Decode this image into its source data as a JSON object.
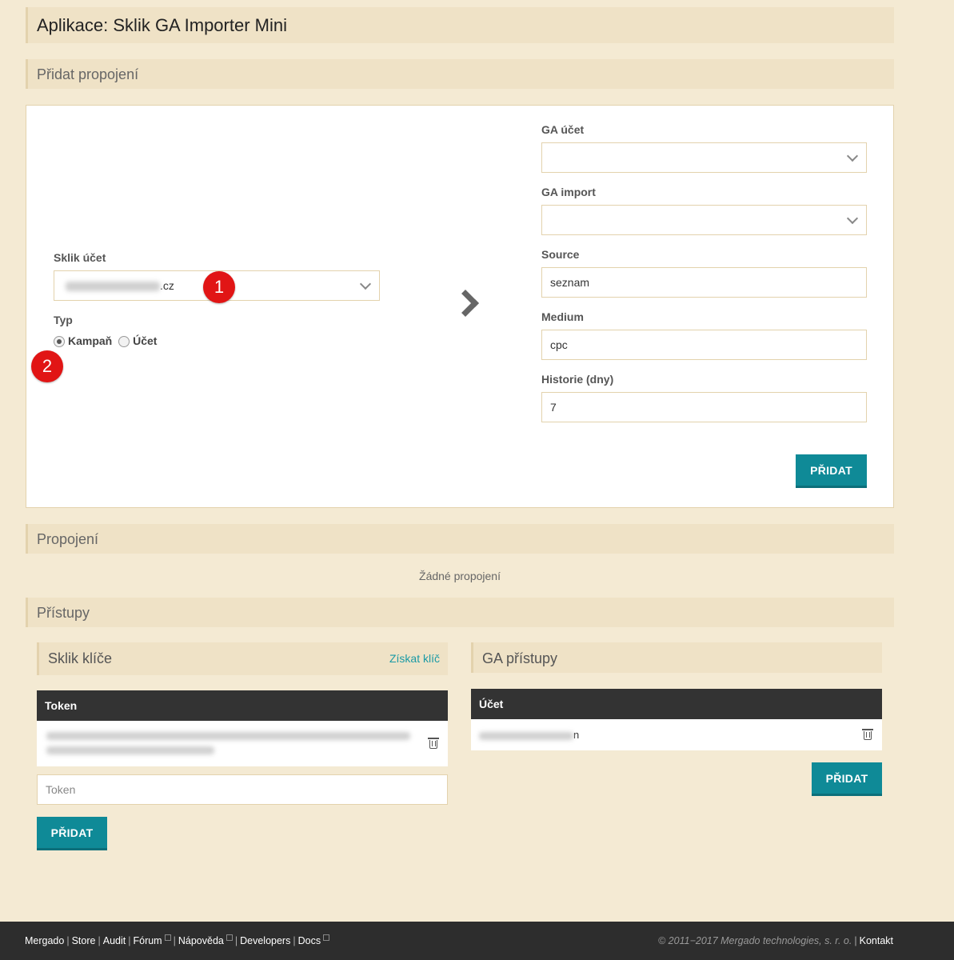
{
  "header": {
    "title": "Aplikace: Sklik GA Importer Mini"
  },
  "add_section": {
    "title": "Přidat propojení",
    "sklik_account_label": "Sklik účet",
    "sklik_account_suffix": ".cz",
    "type_label": "Typ",
    "type_options": [
      "Kampaň",
      "Účet"
    ],
    "type_selected": "Kampaň",
    "badge_1": "1",
    "badge_2": "2",
    "ga_account_label": "GA účet",
    "ga_import_label": "GA import",
    "source_label": "Source",
    "source_value": "seznam",
    "medium_label": "Medium",
    "medium_value": "cpc",
    "history_label": "Historie (dny)",
    "history_value": "7",
    "add_button": "PŘIDAT"
  },
  "connections": {
    "title": "Propojení",
    "empty_text": "Žádné propojení"
  },
  "access": {
    "title": "Přístupy",
    "sklik_keys": {
      "title": "Sklik klíče",
      "get_key_link": "Získat klíč",
      "column_token": "Token",
      "token_placeholder": "Token",
      "add_button": "PŘIDAT"
    },
    "ga_access": {
      "title": "GA přístupy",
      "column_account": "Účet",
      "account_suffix": "n",
      "add_button": "PŘIDAT"
    }
  },
  "footer": {
    "links": [
      "Mergado",
      "Store",
      "Audit",
      "Fórum",
      "Nápověda",
      "Developers",
      "Docs"
    ],
    "copyright": "© 2011−2017 Mergado technologies, s. r. o.",
    "contact": "Kontakt"
  },
  "colors": {
    "background": "#f4ead3",
    "section_bar": "#efe2c6",
    "accent_button": "#0f8a97",
    "badge": "#e11515",
    "table_header": "#333333",
    "footer": "#2d2d2d"
  }
}
